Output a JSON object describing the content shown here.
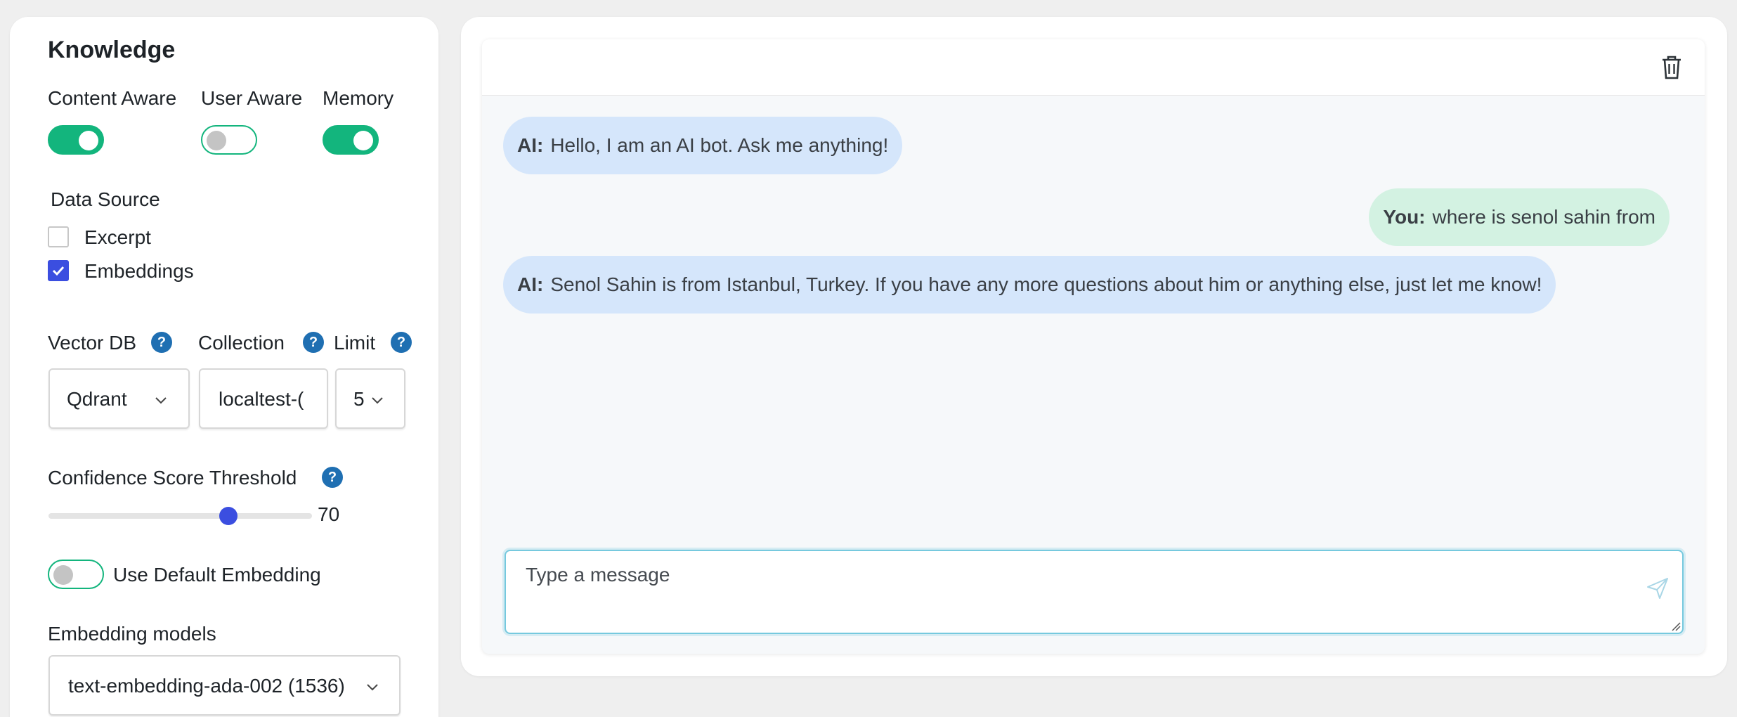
{
  "knowledge": {
    "title": "Knowledge",
    "toggles": [
      {
        "label": "Content Aware",
        "on": true
      },
      {
        "label": "User Aware",
        "on": false
      },
      {
        "label": "Memory",
        "on": true
      }
    ],
    "data_source": {
      "title": "Data Source",
      "options": [
        {
          "label": "Excerpt",
          "checked": false
        },
        {
          "label": "Embeddings",
          "checked": true
        }
      ]
    },
    "vector_db": {
      "label": "Vector DB",
      "value": "Qdrant"
    },
    "collection": {
      "label": "Collection",
      "value": "localtest-("
    },
    "limit": {
      "label": "Limit",
      "value": "5"
    },
    "confidence": {
      "label": "Confidence Score Threshold",
      "value": "70",
      "level": 70
    },
    "default_embedding": {
      "label": "Use Default Embedding",
      "on": false
    },
    "embedding_models": {
      "label": "Embedding models",
      "value": "text-embedding-ada-002 (1536)"
    },
    "help_glyph": "?"
  },
  "chat": {
    "messages": [
      {
        "sender": "AI:",
        "text": "Hello, I am an AI bot. Ask me anything!",
        "role": "ai"
      },
      {
        "sender": "You:",
        "text": "where is senol sahin from",
        "role": "you"
      },
      {
        "sender": "AI:",
        "text": "Senol Sahin is from Istanbul, Turkey. If you have any more questions about him or anything else, just let me know!",
        "role": "ai"
      }
    ],
    "input_placeholder": "Type a message",
    "icons": {
      "clear": "trash-icon",
      "send": "send-icon"
    }
  },
  "colors": {
    "toggle_on": "#13b57d",
    "checkbox_checked": "#3b4ee0",
    "help_icon": "#1f6fb2",
    "ai_bubble": "#d5e6fb",
    "user_bubble": "#d3f2e2",
    "slider_thumb": "#3b4ee0"
  }
}
